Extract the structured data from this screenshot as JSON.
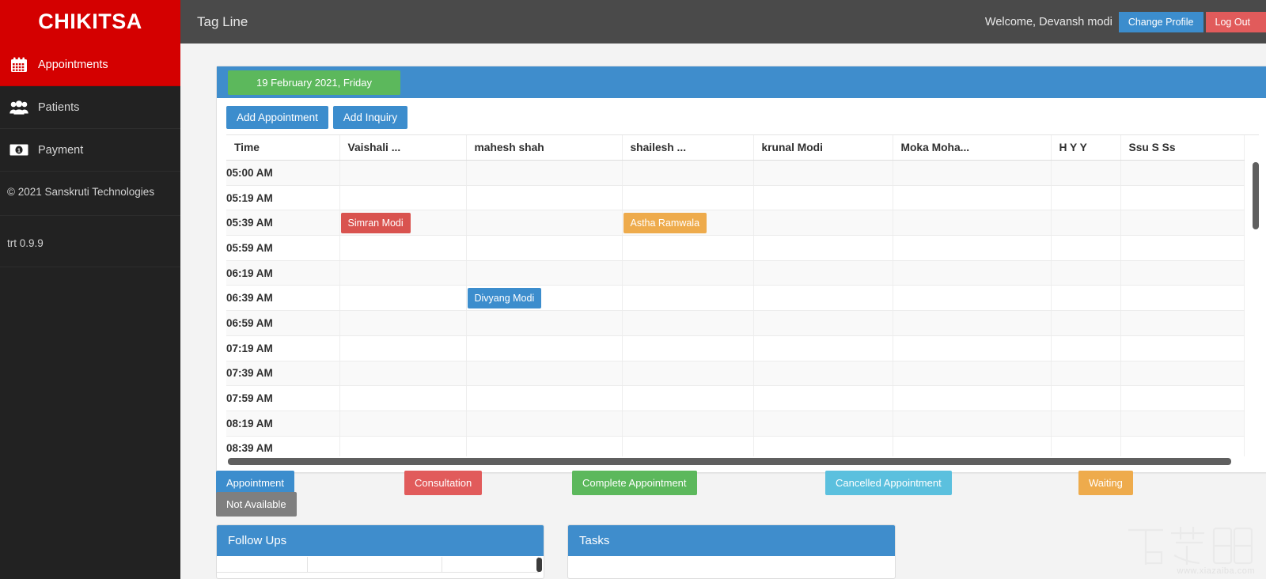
{
  "brand": {
    "name": "CHIKITSA"
  },
  "sidebar": {
    "items": [
      {
        "label": "Appointments",
        "icon": "calendar-icon",
        "active": true
      },
      {
        "label": "Patients",
        "icon": "users-icon",
        "active": false
      },
      {
        "label": "Payment",
        "icon": "money-bill-icon",
        "active": false
      }
    ],
    "copyright": "© 2021 Sanskruti Technologies",
    "version": "trt 0.9.9"
  },
  "topbar": {
    "tagline": "Tag Line",
    "welcome": "Welcome, Devansh modi",
    "change_profile_label": "Change Profile",
    "logout_label": "Log Out"
  },
  "calendar": {
    "date_label": "19 February 2021, Friday",
    "add_appointment_label": "Add Appointment",
    "add_inquiry_label": "Add Inquiry",
    "columns": [
      "Time",
      "Vaishali ...",
      "mahesh shah",
      "shailesh ...",
      "krunal Modi",
      "Moka Moha...",
      "H Y Y",
      "Ssu S Ss"
    ],
    "rows": [
      {
        "time": "05:00 AM",
        "events": []
      },
      {
        "time": "05:19 AM",
        "events": []
      },
      {
        "time": "05:39 AM",
        "events": [
          {
            "column": 1,
            "label": "Simran Modi",
            "color": "#d9534f",
            "status": "consultation"
          },
          {
            "column": 3,
            "label": "Astha Ramwala",
            "color": "#eeab4c",
            "status": "waiting"
          }
        ]
      },
      {
        "time": "05:59 AM",
        "events": []
      },
      {
        "time": "06:19 AM",
        "events": []
      },
      {
        "time": "06:39 AM",
        "events": [
          {
            "column": 2,
            "label": "Divyang Modi",
            "color": "#3c8dcd",
            "status": "appointment"
          }
        ]
      },
      {
        "time": "06:59 AM",
        "events": []
      },
      {
        "time": "07:19 AM",
        "events": []
      },
      {
        "time": "07:39 AM",
        "events": []
      },
      {
        "time": "07:59 AM",
        "events": []
      },
      {
        "time": "08:19 AM",
        "events": []
      },
      {
        "time": "08:39 AM",
        "events": []
      }
    ]
  },
  "legend": [
    {
      "label": "Appointment",
      "color": "#3c8dcd"
    },
    {
      "label": "Consultation",
      "color": "#e15b5b"
    },
    {
      "label": "Complete Appointment",
      "color": "#5cb85c"
    },
    {
      "label": "Cancelled Appointment",
      "color": "#5bc0de"
    },
    {
      "label": "Waiting",
      "color": "#eeab4c"
    },
    {
      "label": "Not Available",
      "color": "#7f7f7f"
    }
  ],
  "panels": {
    "follow_ups_title": "Follow Ups",
    "tasks_title": "Tasks"
  },
  "watermark": {
    "text": "www.xiazaiba.com"
  },
  "colors": {
    "brand_red": "#d40000",
    "sidebar_bg": "#222222",
    "topbar_bg": "#4a4a4a",
    "accent_blue": "#3c8dcd",
    "green": "#5cb85c"
  }
}
